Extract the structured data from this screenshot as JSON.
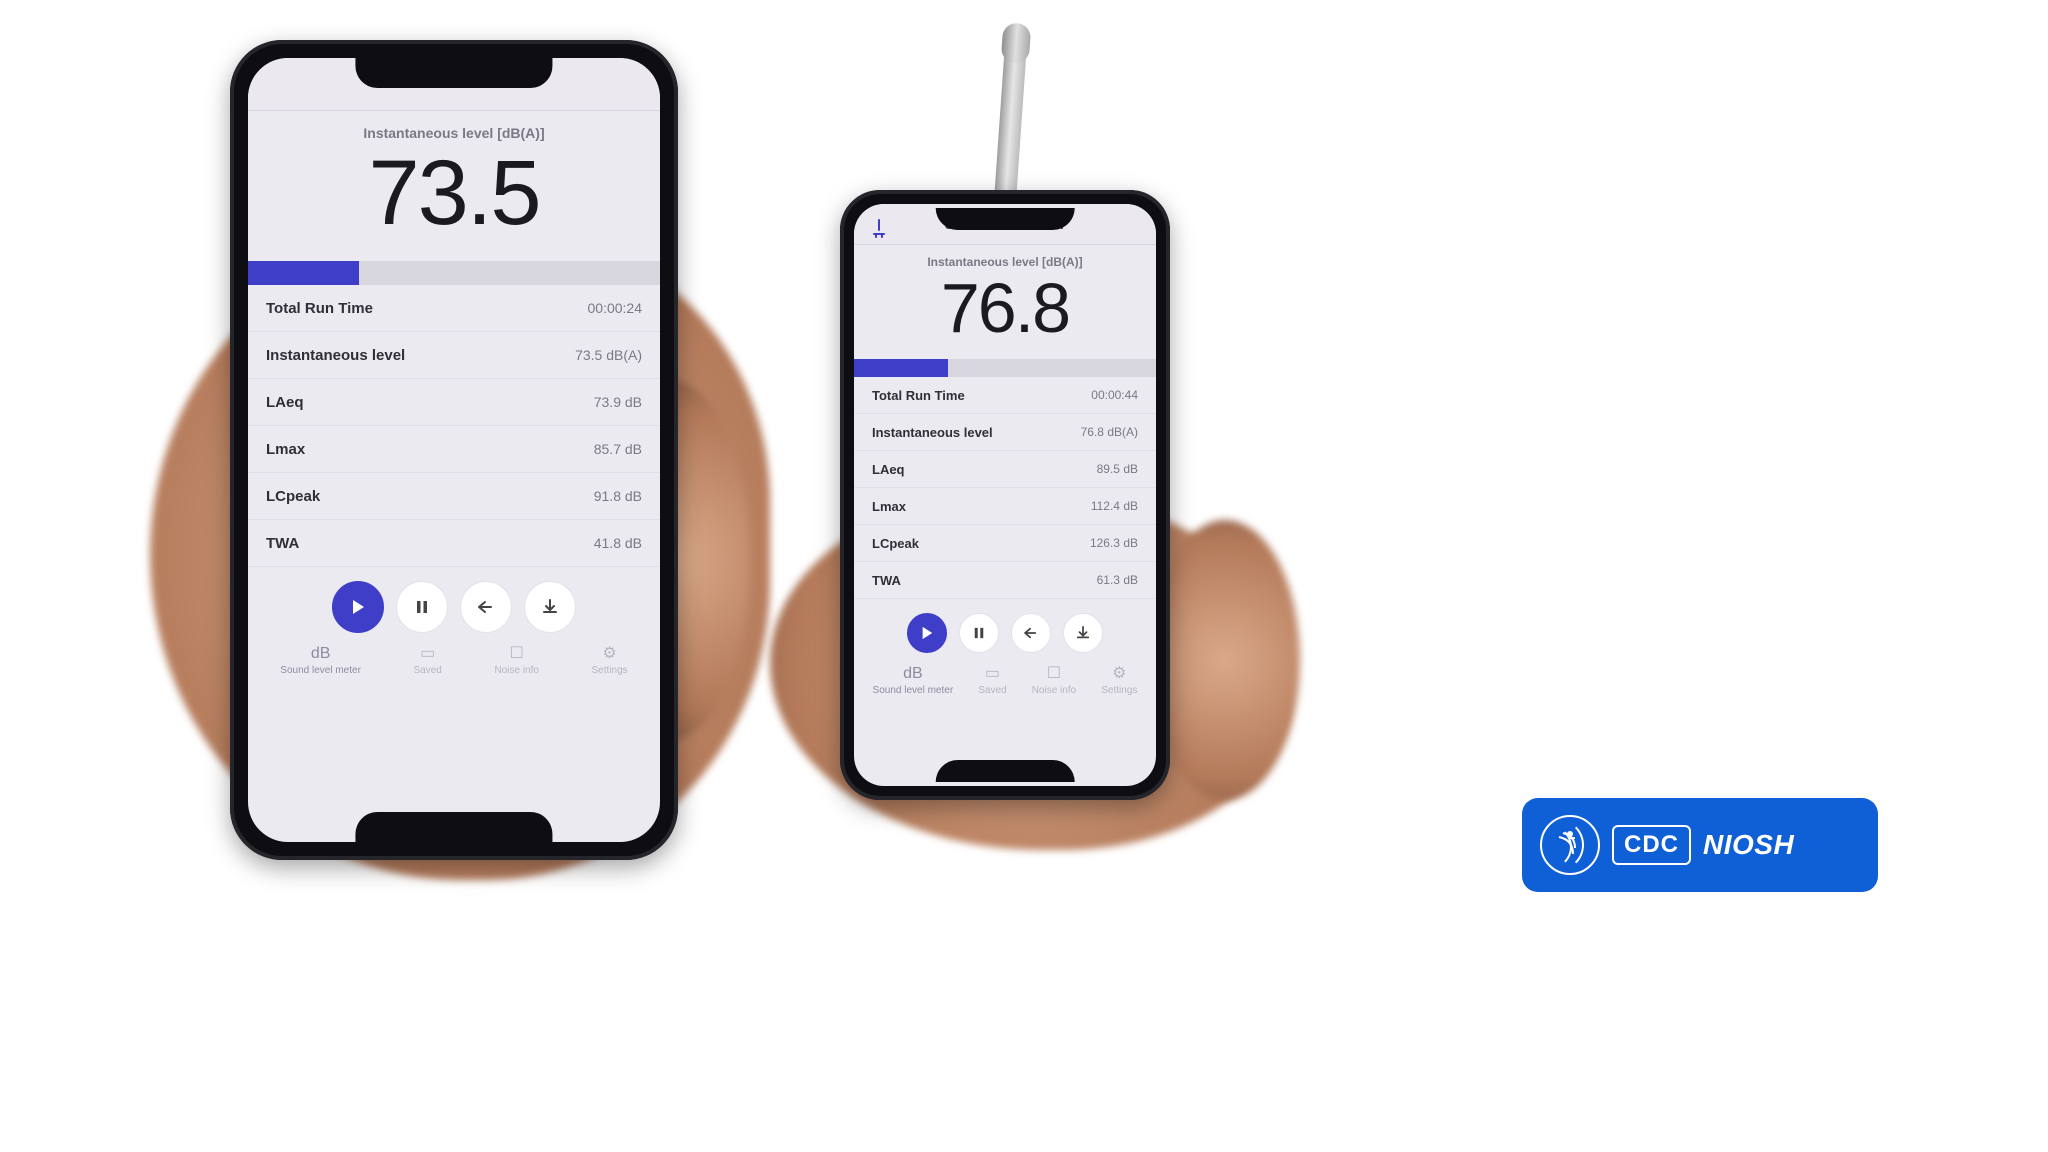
{
  "colors": {
    "accent": "#3e3ec8",
    "badge": "#0f5fd6"
  },
  "phones": [
    {
      "title": "Sound level meter",
      "sub": "Instantaneous level [dB(A)]",
      "reading": "73.5",
      "progress_pct": 27,
      "rows": [
        {
          "label": "Total Run Time",
          "value": "00:00:24"
        },
        {
          "label": "Instantaneous level",
          "value": "73.5 dB(A)"
        },
        {
          "label": "LAeq",
          "value": "73.9 dB"
        },
        {
          "label": "Lmax",
          "value": "85.7 dB"
        },
        {
          "label": "LCpeak",
          "value": "91.8 dB"
        },
        {
          "label": "TWA",
          "value": "41.8 dB"
        }
      ],
      "tabs": [
        {
          "icon": "dB",
          "label": "Sound level meter"
        },
        {
          "icon": "▭",
          "label": "Saved"
        },
        {
          "icon": "☐",
          "label": "Noise info"
        },
        {
          "icon": "⚙",
          "label": "Settings"
        }
      ],
      "big_font_px": 92
    },
    {
      "title": "Sound level meter",
      "sub": "Instantaneous level [dB(A)]",
      "reading": "76.8",
      "progress_pct": 31,
      "rows": [
        {
          "label": "Total Run Time",
          "value": "00:00:44"
        },
        {
          "label": "Instantaneous level",
          "value": "76.8 dB(A)"
        },
        {
          "label": "LAeq",
          "value": "89.5 dB"
        },
        {
          "label": "Lmax",
          "value": "112.4 dB"
        },
        {
          "label": "LCpeak",
          "value": "126.3 dB"
        },
        {
          "label": "TWA",
          "value": "61.3 dB"
        }
      ],
      "tabs": [
        {
          "icon": "dB",
          "label": "Sound level meter"
        },
        {
          "icon": "▭",
          "label": "Saved"
        },
        {
          "icon": "☐",
          "label": "Noise info"
        },
        {
          "icon": "⚙",
          "label": "Settings"
        }
      ],
      "big_font_px": 70,
      "has_external_mic": true
    }
  ],
  "controls": {
    "play": "▶",
    "pause": "❚❚",
    "reset": "↩",
    "save": "⤓"
  },
  "badge": {
    "cdc": "CDC",
    "niosh": "NIOSH"
  }
}
